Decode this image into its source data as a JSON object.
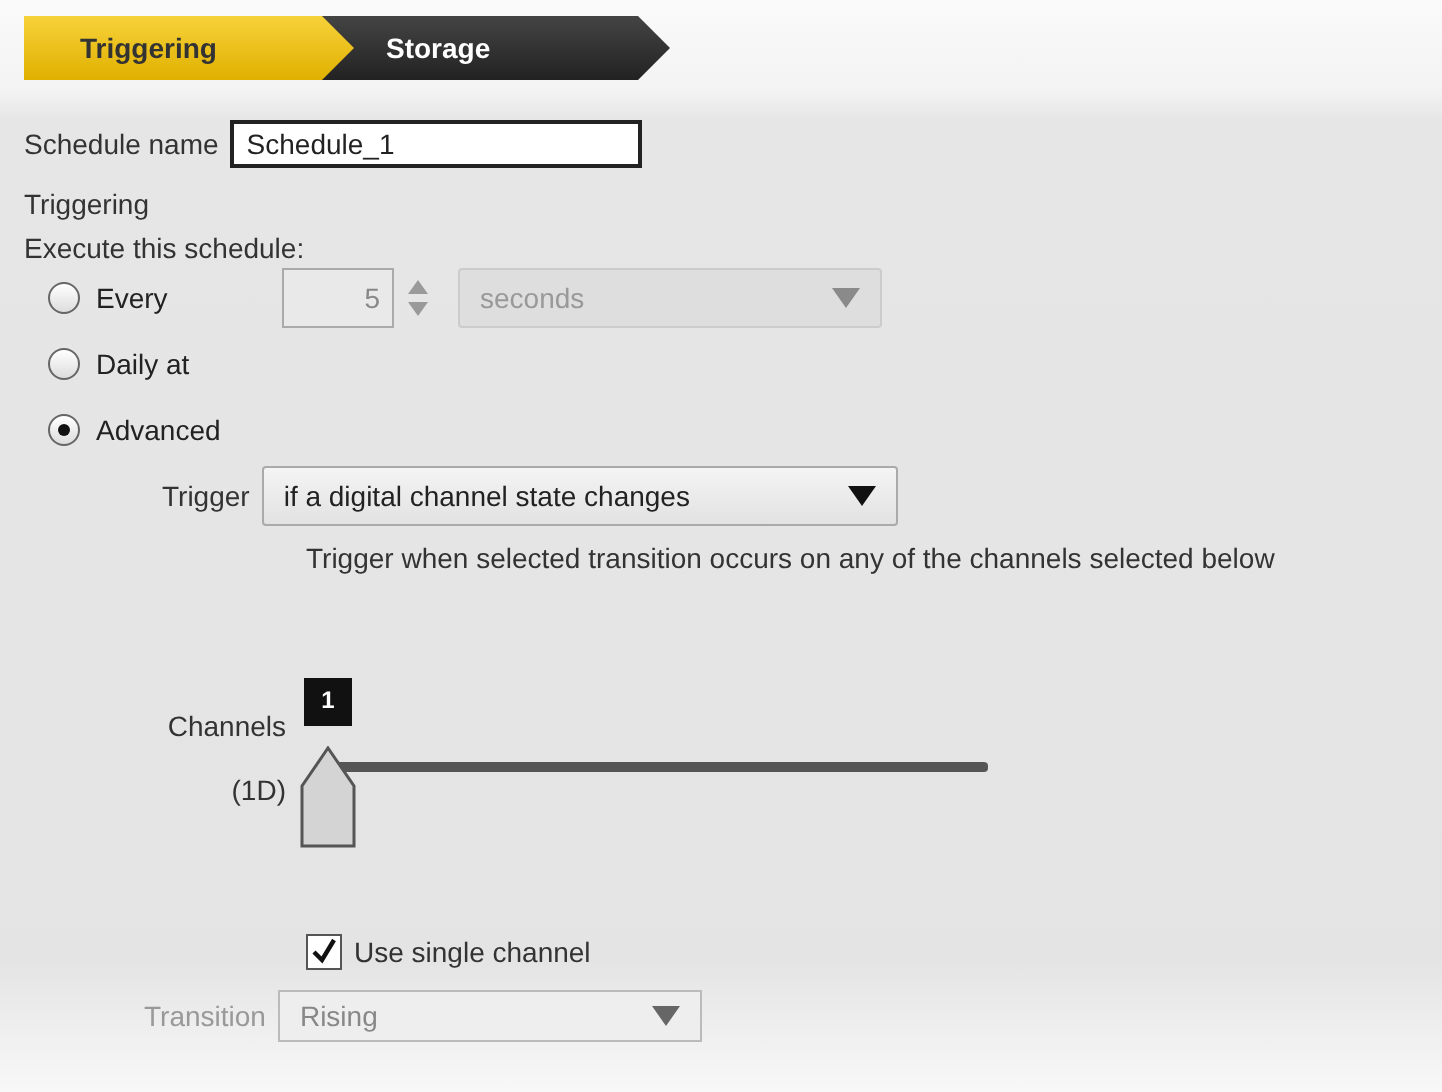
{
  "tabs": [
    {
      "label": "Triggering",
      "selected": true
    },
    {
      "label": "Storage",
      "selected": false
    }
  ],
  "schedule_name": {
    "label": "Schedule name",
    "value": "Schedule_1"
  },
  "section_title": "Triggering",
  "execute_label": "Execute this schedule:",
  "options": [
    {
      "label": "Every",
      "selected": false,
      "kind": "interval",
      "count": "5",
      "unit": "seconds"
    },
    {
      "label": "Daily at",
      "selected": false,
      "kind": "plain"
    },
    {
      "label": "Advanced",
      "selected": true,
      "kind": "plain"
    }
  ],
  "trigger": {
    "label": "Trigger",
    "value": "if a digital channel state changes",
    "description": "Trigger when selected transition occurs on any of the channels selected below"
  },
  "channels": {
    "label": "Channels",
    "sublabel": "(1D)",
    "marker": "1",
    "level": 0
  },
  "use_single_channel": {
    "label": "Use single channel",
    "checked": true
  },
  "transition": {
    "label": "Transition",
    "value": "Rising"
  }
}
